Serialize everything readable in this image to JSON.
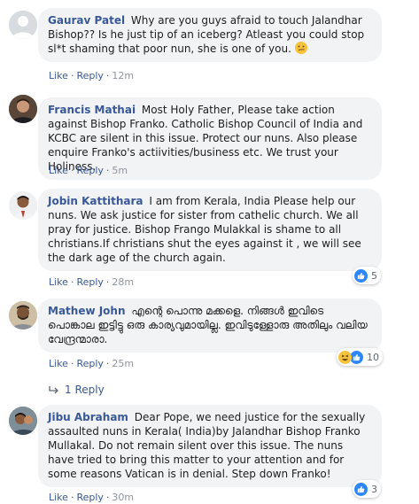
{
  "actions": {
    "like": "Like",
    "reply": "Reply",
    "sep": "·"
  },
  "comments": [
    {
      "author": "Gaurav Patel",
      "text": "Why are you guys afraid to touch Jalandhar Bishop?? Is he just tip of an iceberg? Atleast you could stop sl*t shaming that poor nun, she is one of you.",
      "time": "12m"
    },
    {
      "author": "Francis Mathai",
      "text": "Most Holy Father, Please take action against Bishop Franko. Catholic Bishop Council of India and KCBC are silent in this issue. Protect our nuns. Also please enquire Franko's actiivities/business etc. We trust your Holiness.",
      "time": "5m"
    },
    {
      "author": "Jobin Kattithara",
      "text": "I am from Kerala, India Please help our nuns. We ask justice for sister from cathelic church. We all pray for justice. Bishop Frango Mulakkal is shame to all christians.If christians shut the eyes against it , we will see the dark age of the church again.",
      "time": "28m",
      "reaction_count": "5"
    },
    {
      "author": "Mathew John",
      "text": "എന്റെ പൊന്നു മക്കളെ. നിങ്ങൾ ഇവിടെ പൊങ്കാല ഇട്ടിട്ടു ഒരു കാര്യവുമായില്ല. ഇവിടുള്ളോരു അതിലും വലിയ വേന്ദ്രന്മാരാ.",
      "time": "25m",
      "reaction_count": "10",
      "replies_label": "1 Reply"
    },
    {
      "author": "Jibu Abraham",
      "text": "Dear Pope, we need justice for the sexually assaulted nuns in Kerala( India)by Jalandhar Bishop Franko Mullakal. Do not remain silent over this issue. The nuns have tried to bring this matter to your attention and for some reasons Vatican is in denial. Step down Franko!",
      "time": "30m",
      "reaction_count": "3"
    }
  ]
}
